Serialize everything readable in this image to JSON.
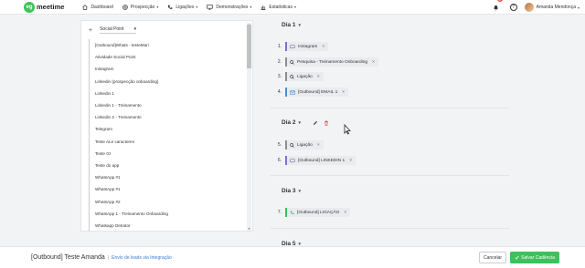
{
  "nav": {
    "logo_mark": "eg",
    "logo_text": "meetime",
    "items": [
      {
        "label": "Dashboard",
        "icon": "home-icon",
        "caret": false
      },
      {
        "label": "Prospecção",
        "icon": "compass-icon",
        "caret": true
      },
      {
        "label": "Ligações",
        "icon": "phone-icon",
        "caret": true
      },
      {
        "label": "Demonstrações",
        "icon": "monitor-icon",
        "caret": true
      },
      {
        "label": "Estatísticas",
        "icon": "chart-icon",
        "caret": true
      }
    ],
    "notification_count": "1",
    "help_label": "?",
    "user_name": "Amanda Mendonça"
  },
  "left_panel": {
    "plus": "+",
    "selected_channel": "Social Point",
    "items": [
      "[Outbound]Whats - testeMari",
      "Atividade Social Point",
      "Instagram",
      "Linkedin (prospecção onboarding)",
      "Linkedin 1",
      "Linkedin 1 - Treinamento",
      "Linkedin 2 - Treinamento",
      "Telegram",
      "Teste ALe caracteres",
      "Teste GI",
      "Teste do app",
      "WhatsApp #1",
      "WhatsApp #1",
      "WhatsApp #2",
      "WhatsApp 1 - Treinamento Onboarding",
      "Whatsapp Detrator"
    ]
  },
  "days": [
    {
      "title": "Dia 1",
      "steps": [
        {
          "num": "1.",
          "label": "Instagram",
          "type": "social"
        },
        {
          "num": "2.",
          "label": "Pesquisa - Treinamento Onboarding",
          "type": "search"
        },
        {
          "num": "3.",
          "label": "Ligação",
          "type": "search"
        },
        {
          "num": "4.",
          "label": "[Outbound] EMAIL 1",
          "type": "email"
        }
      ]
    },
    {
      "title": "Dia 2",
      "steps": [
        {
          "num": "5.",
          "label": "Ligação",
          "type": "search"
        },
        {
          "num": "6.",
          "label": "[Outbound] LINKEDIN 1",
          "type": "social"
        }
      ]
    },
    {
      "title": "Dia 3",
      "steps": [
        {
          "num": "7.",
          "label": "[Outbound] LIGAÇÃO",
          "type": "call"
        }
      ]
    },
    {
      "title": "Dia 5",
      "steps": []
    }
  ],
  "remove_label": "×",
  "footer": {
    "title": "[Outbound] Teste Amanda",
    "separator": "|",
    "link": "Envio de leads via Integração",
    "cancel_label": "Cancelar",
    "save_label": "Salvar Cadência"
  },
  "colors": {
    "brand_green": "#3cc15b",
    "social_accent": "#7a72c7",
    "email_accent": "#4b8fd6",
    "delete_red": "#e05252"
  }
}
